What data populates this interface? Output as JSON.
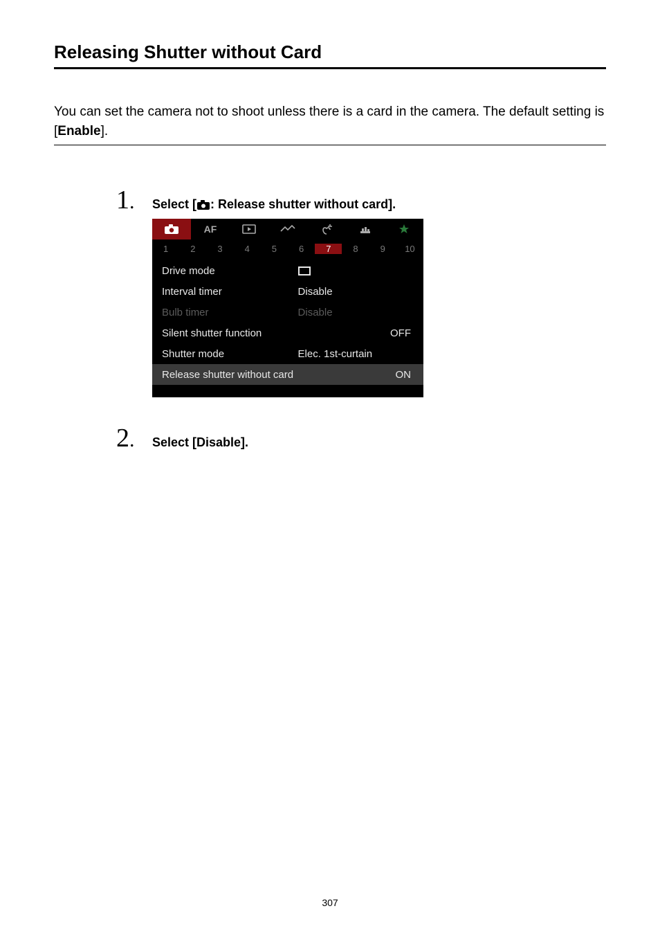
{
  "title": "Releasing Shutter without Card",
  "intro_prefix": "You can set the camera not to shoot unless there is a card in the camera. The default setting is [",
  "intro_bold": "Enable",
  "intro_suffix": "].",
  "steps": {
    "num1": "1",
    "num2": "2",
    "dot": ".",
    "label1_prefix": "Select [",
    "label1_suffix": ": Release shutter without card].",
    "label2": "Select [Disable]."
  },
  "menu": {
    "tabs": {
      "af": "AF"
    },
    "pages": [
      "1",
      "2",
      "3",
      "4",
      "5",
      "6",
      "7",
      "8",
      "9",
      "10"
    ],
    "active_page_index": 6,
    "rows": [
      {
        "label": "Drive mode",
        "value_type": "icon"
      },
      {
        "label": "Interval timer",
        "value": "Disable"
      },
      {
        "label": "Bulb timer",
        "value": "Disable",
        "dim": true
      },
      {
        "label": "Silent shutter function",
        "value": "OFF",
        "align": "right"
      },
      {
        "label": "Shutter mode",
        "value": "Elec. 1st-curtain"
      },
      {
        "label": "Release shutter without card",
        "value": "ON",
        "align": "right",
        "highlight": true
      }
    ]
  },
  "page_number": "307"
}
